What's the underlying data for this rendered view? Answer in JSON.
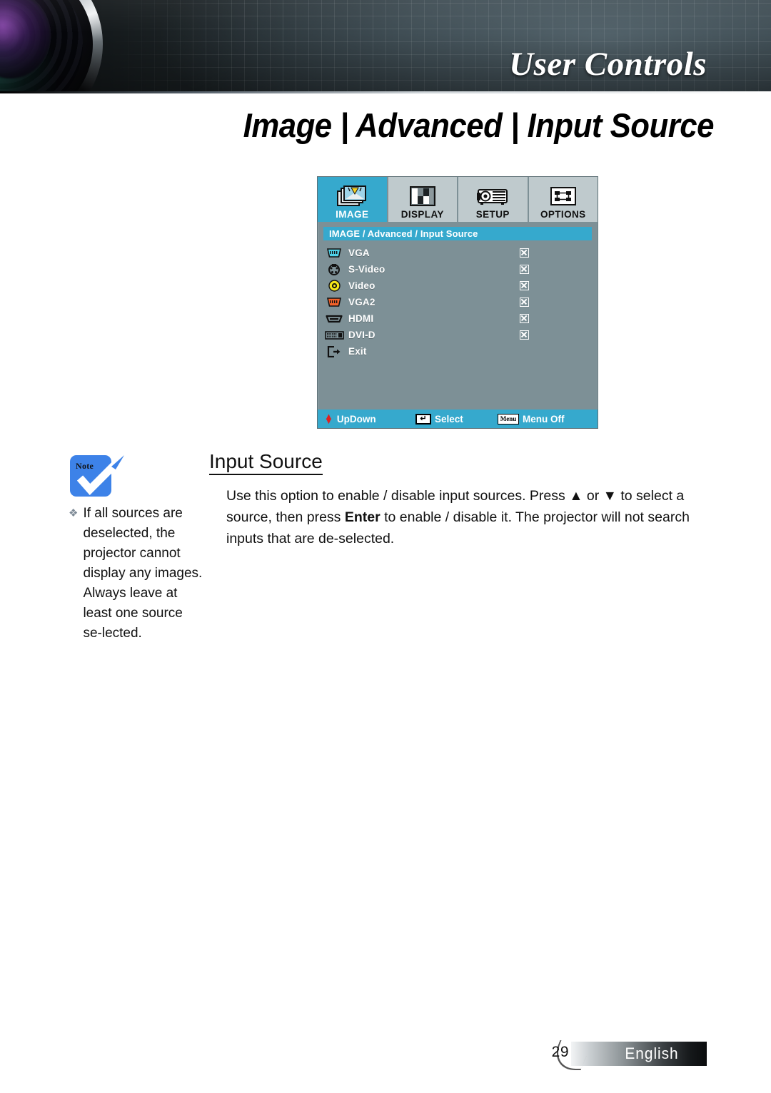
{
  "header": {
    "title": "User Controls",
    "lens_icon": "camera-lens-graphic"
  },
  "page_title": "Image | Advanced | Input Source",
  "osd": {
    "tabs": [
      {
        "label": "IMAGE",
        "icon": "image-tab-icon",
        "active": true
      },
      {
        "label": "DISPLAY",
        "icon": "display-tab-icon",
        "active": false
      },
      {
        "label": "SETUP",
        "icon": "setup-tab-icon",
        "active": false
      },
      {
        "label": "OPTIONS",
        "icon": "options-tab-icon",
        "active": false
      }
    ],
    "breadcrumb": "IMAGE / Advanced / Input Source",
    "rows": [
      {
        "label": "VGA",
        "icon": "vga-connector-icon",
        "checked": true
      },
      {
        "label": "S-Video",
        "icon": "svideo-connector-icon",
        "checked": true
      },
      {
        "label": "Video",
        "icon": "composite-video-icon",
        "checked": true
      },
      {
        "label": "VGA2",
        "icon": "vga2-connector-icon",
        "checked": true
      },
      {
        "label": "HDMI",
        "icon": "hdmi-connector-icon",
        "checked": true
      },
      {
        "label": "DVI-D",
        "icon": "dvid-connector-icon",
        "checked": true
      },
      {
        "label": "Exit",
        "icon": "exit-icon",
        "checked": false
      }
    ],
    "footer": {
      "updown_label": "UpDown",
      "updown_icon": "up-down-arrows-icon",
      "select_label": "Select",
      "select_icon": "enter-key-icon",
      "select_key_glyph": "↵",
      "menuoff_label": "Menu Off",
      "menuoff_key_label": "Menu"
    },
    "colors": {
      "accent": "#36a9cd",
      "panel": "#7d9096",
      "tab_inactive": "#bfcacd"
    }
  },
  "note": {
    "badge_label": "Note",
    "badge_color": "#3d82e8",
    "bullet": "❖",
    "text": "If all sources are deselected, the projector cannot display any images. Always leave at least one source se-lected."
  },
  "main": {
    "heading": "Input Source",
    "body_part1": "Use this option to enable / disable input sources. Press ▲ or ▼ to select a source, then press ",
    "body_bold": "Enter",
    "body_part2": " to enable / disable it. The projector will not search inputs that are de-selected."
  },
  "footer": {
    "page_number": "29",
    "language": "English"
  }
}
